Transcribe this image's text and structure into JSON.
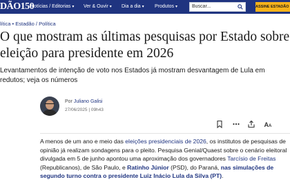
{
  "header": {
    "logo": "DÃO150",
    "nav": [
      {
        "label": "Notícias / Editorias",
        "chevron": true
      },
      {
        "label": "Ver & Ouvir",
        "chevron": true
      },
      {
        "label": "Dia a dia",
        "chevron": true
      },
      {
        "label": "Produtos",
        "chevron": true
      }
    ],
    "search_label": "Buscar...",
    "subscribe_label": "ASSINE ESTADÃO +"
  },
  "breadcrumb": {
    "section": "lítica",
    "source": "Estadão",
    "topic": "Política"
  },
  "article": {
    "title": "O que mostram as últimas pesquisas por Estado sobre a eleição para presidente em 2026",
    "subtitle": "Levantamentos de intenção de voto nos Estados já mostram desvantagem de Lula em redutos; veja os números",
    "author_prefix": "Por",
    "author_name": "Juliano Galisi",
    "date": "27/06/2025 | 09h43",
    "body": {
      "p1": "A menos de um ano e meio das ",
      "link1": "eleições presidenciais de 2026",
      "p2": ", os institutos de pesquisas de opinião já realizam sondagens para o pleito. Pesquisa Genial/Quaest sobre o cenário eleitoral divulgada em 5 de junho apontou uma aproximação dos governadores ",
      "link2": "Tarcísio de Freitas",
      "p3": " (Republicanos), de São Paulo, e ",
      "link3": "Ratinho Júnior",
      "p4": " (PSD), do Paraná, ",
      "link4": "nas simulações de segundo turno contra o presidente Luiz Inácio Lula da Silva (PT)",
      "p5": "."
    }
  },
  "icons": [
    "search-icon",
    "bookmark-icon",
    "more-icon",
    "share-icon",
    "font-size-icon"
  ],
  "colors": {
    "nav_bg": "#1f3480",
    "accent_yellow": "#f6b21b",
    "link": "#1f3480"
  }
}
